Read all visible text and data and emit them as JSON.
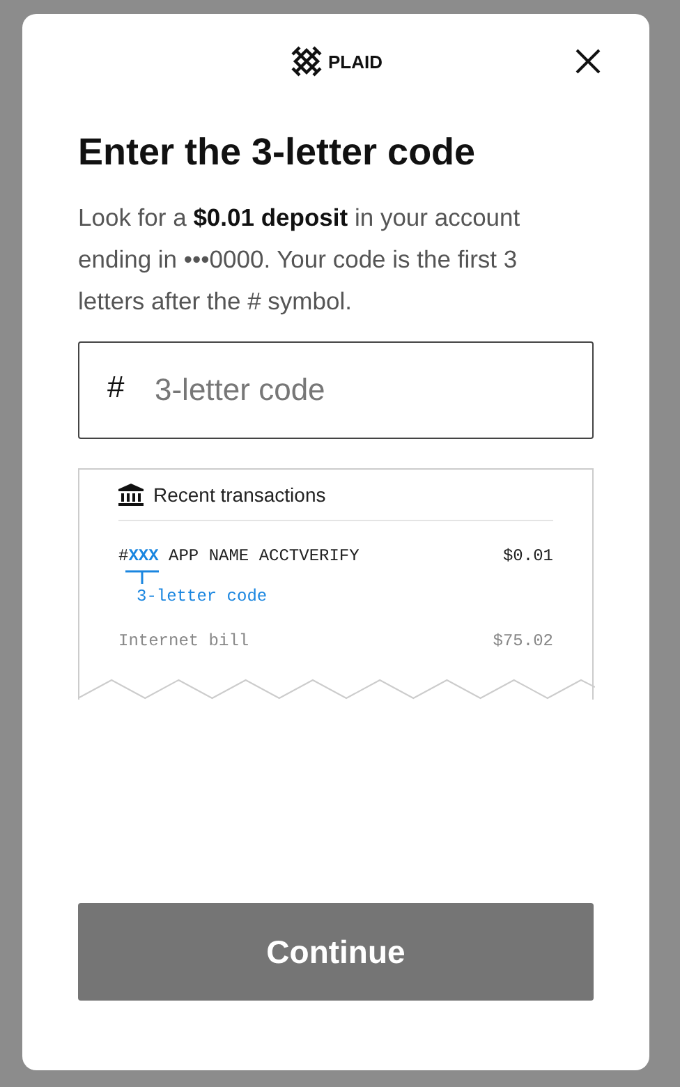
{
  "brand": "PLAID",
  "title": "Enter the 3-letter code",
  "description": "Look for a **$0.01 deposit** in your account ending in •••0000. Your code is the first 3 letters after the # symbol.",
  "code_field": {
    "prefix": "#",
    "placeholder": "3-letter code"
  },
  "receipt": {
    "header": "Recent transactions",
    "transactions": [
      {
        "kind": "verify",
        "hash": "#",
        "code": "XXX",
        "memo": "APP NAME ACCTVERIFY",
        "amount": "$0.01",
        "code_label": "3-letter code"
      },
      {
        "kind": "plain",
        "memo": "Internet bill",
        "amount": "$75.02"
      }
    ]
  },
  "button": "Continue"
}
